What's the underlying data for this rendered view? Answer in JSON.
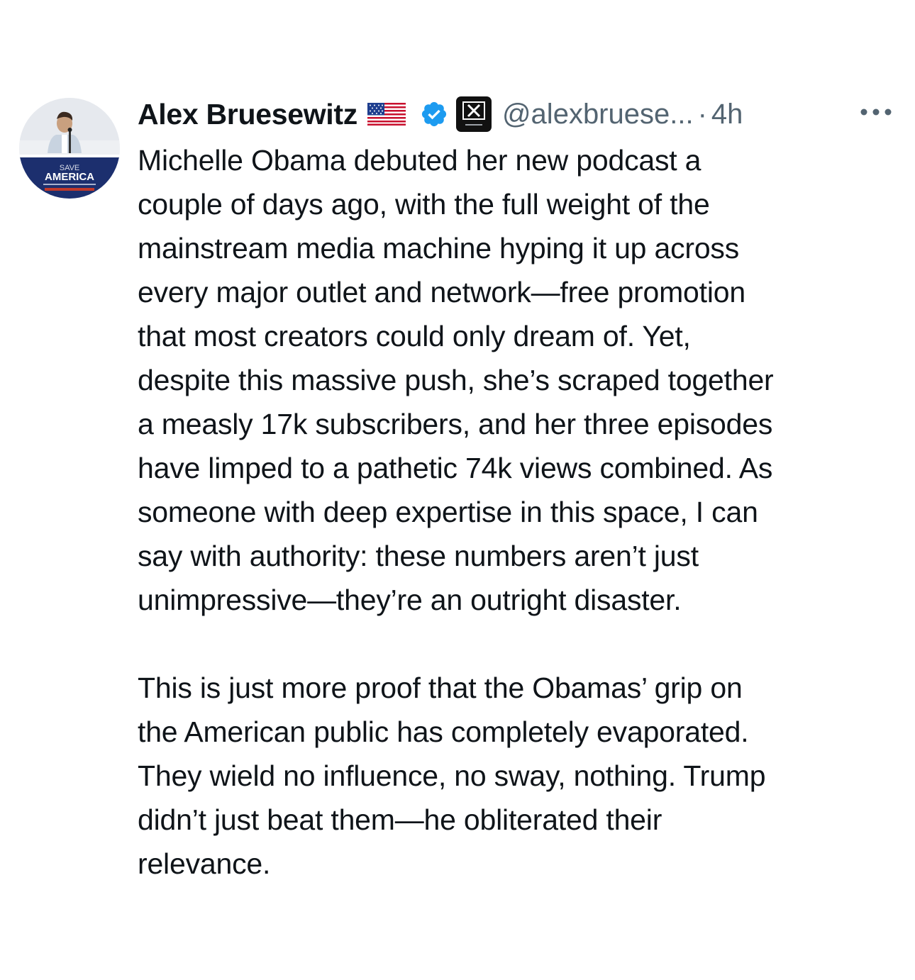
{
  "author": {
    "display_name": "Alex Bruesewitz",
    "flag_emoji": "us-flag-icon",
    "verified": "verified-badge-icon",
    "affiliate": "x-strategies-affiliate-badge",
    "handle": "@alexbruese...",
    "separator": "·",
    "timestamp": "4h",
    "avatar_text": {
      "line1": "SAVE",
      "line2": "AMERICA"
    }
  },
  "post": {
    "paragraph1": "Michelle Obama debuted her new podcast a\ncouple of days ago, with the full weight of the\nmainstream media machine hyping it up across\nevery major outlet and network—free promotion\nthat most creators could only dream of. Yet,\ndespite this massive push, she’s scraped together\na measly 17k subscribers, and her three episodes\nhave limped to a pathetic 74k views combined. As\nsomeone with deep expertise in this space, I can\nsay with authority: these numbers aren’t just\nunimpressive—they’re an outright disaster.",
    "paragraph2": "This is just more proof that the Obamas’ grip on\nthe American public has completely evaporated.\nThey wield no influence, no sway, nothing. Trump\ndidn’t just beat them—he obliterated their\nrelevance."
  },
  "colors": {
    "text": "#0f1419",
    "secondary": "#536471",
    "verified_blue": "#1d9bf0",
    "banner_navy": "#1c2f6e"
  }
}
